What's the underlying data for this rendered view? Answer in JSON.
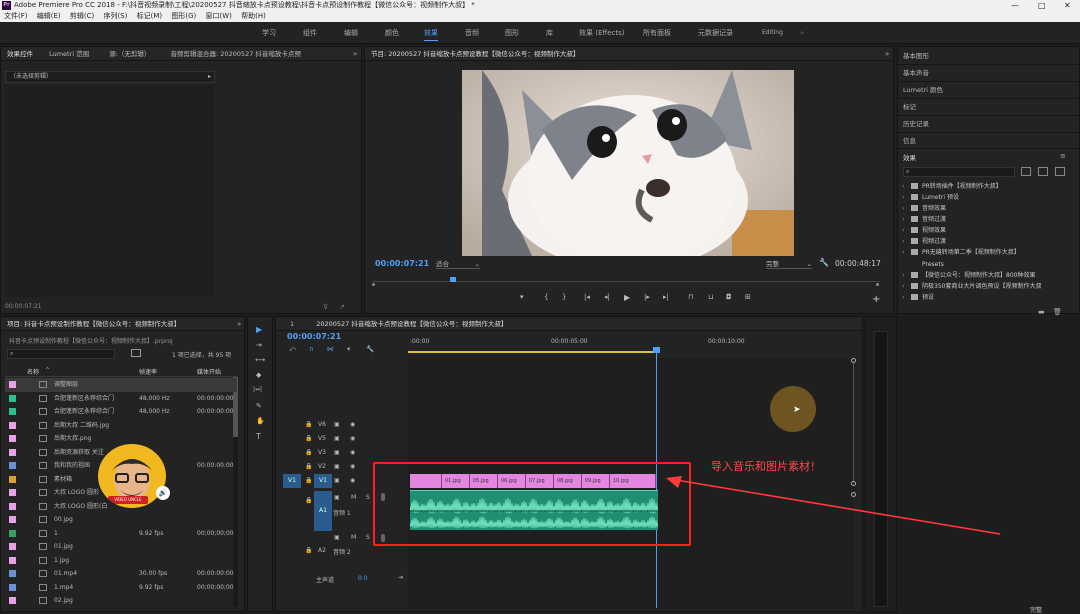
{
  "titlebar": {
    "app_label": "Pr",
    "title": "Adobe Premiere Pro CC 2018 - F:\\抖音视频录制\\工程\\20200527 抖音缩放卡点预设教程\\抖音卡点预设制作教程【微信公众号：视频制作大叔】 *",
    "min": "—",
    "max": "□",
    "close": "✕"
  },
  "menubar": [
    "文件(F)",
    "编辑(E)",
    "剪辑(C)",
    "序列(S)",
    "标记(M)",
    "图形(G)",
    "窗口(W)",
    "帮助(H)"
  ],
  "workspaces": [
    {
      "label": "学习"
    },
    {
      "label": "组件"
    },
    {
      "label": "编辑"
    },
    {
      "label": "颜色"
    },
    {
      "label": "效果",
      "active": true
    },
    {
      "label": "音频"
    },
    {
      "label": "图形"
    },
    {
      "label": "库"
    },
    {
      "label": "效果 (Effects)"
    },
    {
      "label": "所有面板"
    },
    {
      "label": "元数据记录"
    },
    {
      "label": "Editing"
    }
  ],
  "source_panel": {
    "tabs": [
      "效果控件",
      "Lumetri 范围",
      "源:（无剪辑）",
      "音频剪辑混合器: 20200527 抖音缩放卡点预"
    ],
    "dropdown": "（未选择剪辑）",
    "timecode": "00:00:07:21"
  },
  "program": {
    "tab": "节目: 20200527 抖音缩放卡点预设教程【微信公众号：视频制作大叔】",
    "timecode": "00:00:07:21",
    "fit": "适合",
    "quality": "完整",
    "duration": "00:00:48:17"
  },
  "project": {
    "tab": "项目: 抖音卡点预设制作教程【微信公众号：视频制作大叔】",
    "file": "抖音卡点预设制作教程【微信公众号：视频制作大叔】.prproj",
    "selection": "1 项已选择，共 95 项",
    "col_name": "名称",
    "col_rate": "帧速率",
    "col_start": "媒体开始",
    "rows": [
      {
        "name": "调整图层",
        "rate": "",
        "start": "",
        "color": "#e8a0e6",
        "sel": true
      },
      {
        "name": "合肥蓬新区永荐综合门",
        "rate": "48,000 Hz",
        "start": "00:00:00:00",
        "color": "#2fbf8f"
      },
      {
        "name": "合肥蓬新区永荐综合门",
        "rate": "48,000 Hz",
        "start": "00:00:00:00",
        "color": "#2fbf8f"
      },
      {
        "name": "后期大叔 二维码.jpg",
        "rate": "",
        "start": "",
        "color": "#e8a0e6"
      },
      {
        "name": "后期大叔.png",
        "rate": "",
        "start": "",
        "color": "#e8a0e6"
      },
      {
        "name": "后期资源获取 关注",
        "rate": "",
        "start": "",
        "color": "#e8a0e6"
      },
      {
        "name": "我和我的祖国",
        "rate": "",
        "start": "00:00:00:00",
        "color": "#6c8fd8"
      },
      {
        "name": "素材箱",
        "rate": "",
        "start": "",
        "color": "#d9a03a"
      },
      {
        "name": "大叔 LOGO 圆形",
        "rate": "",
        "start": "",
        "color": "#e8a0e6"
      },
      {
        "name": "大叔 LOGO 圆形(白",
        "rate": "",
        "start": "",
        "color": "#e8a0e6"
      },
      {
        "name": "00.jpg",
        "rate": "",
        "start": "",
        "color": "#e8a0e6"
      },
      {
        "name": "1",
        "rate": "9.92 fps",
        "start": "00;00;00;00",
        "color": "#3aa060"
      },
      {
        "name": "01.jpg",
        "rate": "",
        "start": "",
        "color": "#e8a0e6"
      },
      {
        "name": "1.jpg",
        "rate": "",
        "start": "",
        "color": "#e8a0e6"
      },
      {
        "name": "01.mp4",
        "rate": "30.00 fps",
        "start": "00:00:00:00",
        "color": "#6c8fd8"
      },
      {
        "name": "1.mp4",
        "rate": "9.92 fps",
        "start": "00;00;00;00",
        "color": "#6c8fd8"
      },
      {
        "name": "02.jpg",
        "rate": "",
        "start": "",
        "color": "#e8a0e6"
      }
    ]
  },
  "timeline": {
    "tab_num": "1",
    "tab": "20200527 抖音缩放卡点预设教程【微信公众号：视频制作大叔】",
    "timecode": "00:00:07:21",
    "ruler": [
      ":00:00",
      "00:00:05:00",
      "00:00:10:00"
    ],
    "tracks": [
      {
        "label": "V6"
      },
      {
        "label": "V5"
      },
      {
        "label": "V3"
      },
      {
        "label": "V2"
      },
      {
        "label": "V1",
        "active": true,
        "source": "V1"
      },
      {
        "label": "A1",
        "active": true,
        "source": "",
        "name": "音频 1"
      },
      {
        "label": "A2",
        "name": "音频 2"
      }
    ],
    "master": "主声道",
    "master_val": "0.0",
    "clips": [
      "01.jpg",
      "05.jpg",
      "06.jpg",
      "07.jpg",
      "08.jpg",
      "09.jpg",
      "10.jpg"
    ],
    "annotation": "导入音乐和图片素材！",
    "letters": {
      "m": "M",
      "s": "S"
    }
  },
  "tools": [
    "▶",
    "⇥",
    "⟷",
    "◆",
    "|↔|",
    "✎",
    "✋",
    "T"
  ],
  "right_panels": [
    "基本图形",
    "基本声音",
    "Lumetri 颜色",
    "标记",
    "历史记录",
    "信息"
  ],
  "effects": {
    "title": "效果",
    "items": [
      "PR转场插件【视频制作大叔】",
      "Lumetri 预设",
      "音频效果",
      "音频过渡",
      "视频效果",
      "视频过渡",
      "PR无缝转场第二季【视频制作大叔】",
      "Presets",
      "【微信公众号：视频制作大叔】800种效果",
      "阴极350套商业大片调色预设【视频制作大叔",
      "预设"
    ]
  },
  "status_right": "完整",
  "avatar_badge": "VIDEO UNCLE",
  "accent": "#4ea1f3",
  "annotation_color": "#ff3b3b"
}
